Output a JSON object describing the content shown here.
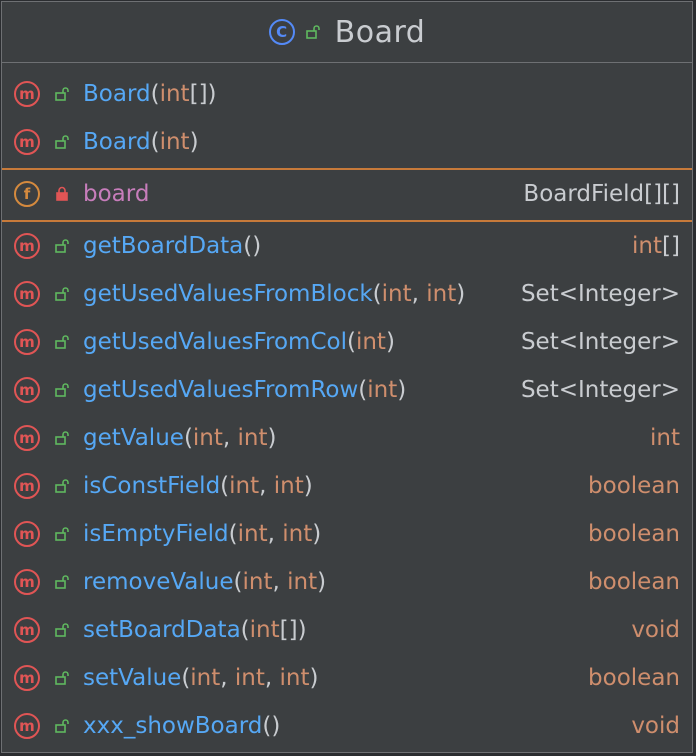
{
  "class": {
    "kind_glyph": "C",
    "name": "Board",
    "icon": "class-icon"
  },
  "constructors": [
    {
      "glyph": "m",
      "name": "Board",
      "params": "int[]",
      "visibility": "public"
    },
    {
      "glyph": "m",
      "name": "Board",
      "params": "int",
      "visibility": "public"
    }
  ],
  "fields": [
    {
      "glyph": "f",
      "name": "board",
      "type": "BoardField[][]",
      "visibility": "private"
    }
  ],
  "methods": [
    {
      "glyph": "m",
      "name": "getBoardData",
      "params": "",
      "ret": "int[]",
      "ret_kind": "kw"
    },
    {
      "glyph": "m",
      "name": "getUsedValuesFromBlock",
      "params": "int, int",
      "ret": "Set<Integer>",
      "ret_kind": "cls"
    },
    {
      "glyph": "m",
      "name": "getUsedValuesFromCol",
      "params": "int",
      "ret": "Set<Integer>",
      "ret_kind": "cls"
    },
    {
      "glyph": "m",
      "name": "getUsedValuesFromRow",
      "params": "int",
      "ret": "Set<Integer>",
      "ret_kind": "cls"
    },
    {
      "glyph": "m",
      "name": "getValue",
      "params": "int, int",
      "ret": "int",
      "ret_kind": "kw"
    },
    {
      "glyph": "m",
      "name": "isConstField",
      "params": "int, int",
      "ret": "boolean",
      "ret_kind": "kw"
    },
    {
      "glyph": "m",
      "name": "isEmptyField",
      "params": "int, int",
      "ret": "boolean",
      "ret_kind": "kw"
    },
    {
      "glyph": "m",
      "name": "removeValue",
      "params": "int, int",
      "ret": "boolean",
      "ret_kind": "kw"
    },
    {
      "glyph": "m",
      "name": "setBoardData",
      "params": "int[]",
      "ret": "void",
      "ret_kind": "kw"
    },
    {
      "glyph": "m",
      "name": "setValue",
      "params": "int, int, int",
      "ret": "boolean",
      "ret_kind": "kw"
    },
    {
      "glyph": "m",
      "name": "xxx_showBoard",
      "params": "",
      "ret": "void",
      "ret_kind": "kw"
    }
  ],
  "colors": {
    "method_name": "#56a8f5",
    "field_name": "#c77dbb",
    "keyword": "#cf8e6d",
    "separator": "#c77a3a",
    "class_icon": "#548af7",
    "method_icon": "#e05555",
    "field_icon": "#d58a3e",
    "public_lock": "#5fb85f",
    "private_lock": "#e05555"
  }
}
